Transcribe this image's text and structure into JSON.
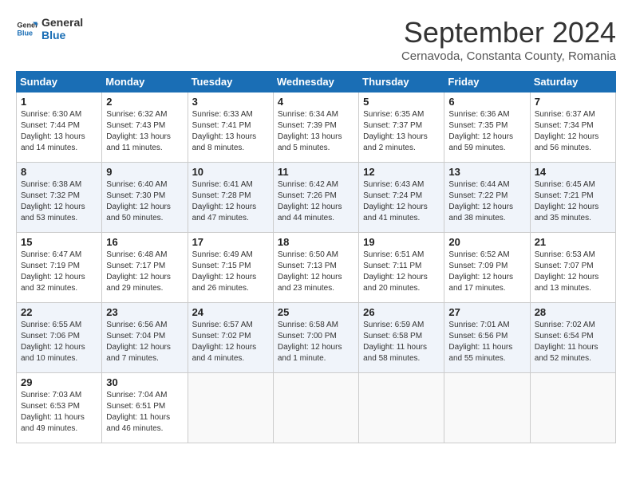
{
  "logo": {
    "line1": "General",
    "line2": "Blue"
  },
  "title": "September 2024",
  "subtitle": "Cernavoda, Constanta County, Romania",
  "days_of_week": [
    "Sunday",
    "Monday",
    "Tuesday",
    "Wednesday",
    "Thursday",
    "Friday",
    "Saturday"
  ],
  "weeks": [
    [
      {
        "day": "1",
        "info": "Sunrise: 6:30 AM\nSunset: 7:44 PM\nDaylight: 13 hours\nand 14 minutes."
      },
      {
        "day": "2",
        "info": "Sunrise: 6:32 AM\nSunset: 7:43 PM\nDaylight: 13 hours\nand 11 minutes."
      },
      {
        "day": "3",
        "info": "Sunrise: 6:33 AM\nSunset: 7:41 PM\nDaylight: 13 hours\nand 8 minutes."
      },
      {
        "day": "4",
        "info": "Sunrise: 6:34 AM\nSunset: 7:39 PM\nDaylight: 13 hours\nand 5 minutes."
      },
      {
        "day": "5",
        "info": "Sunrise: 6:35 AM\nSunset: 7:37 PM\nDaylight: 13 hours\nand 2 minutes."
      },
      {
        "day": "6",
        "info": "Sunrise: 6:36 AM\nSunset: 7:35 PM\nDaylight: 12 hours\nand 59 minutes."
      },
      {
        "day": "7",
        "info": "Sunrise: 6:37 AM\nSunset: 7:34 PM\nDaylight: 12 hours\nand 56 minutes."
      }
    ],
    [
      {
        "day": "8",
        "info": "Sunrise: 6:38 AM\nSunset: 7:32 PM\nDaylight: 12 hours\nand 53 minutes."
      },
      {
        "day": "9",
        "info": "Sunrise: 6:40 AM\nSunset: 7:30 PM\nDaylight: 12 hours\nand 50 minutes."
      },
      {
        "day": "10",
        "info": "Sunrise: 6:41 AM\nSunset: 7:28 PM\nDaylight: 12 hours\nand 47 minutes."
      },
      {
        "day": "11",
        "info": "Sunrise: 6:42 AM\nSunset: 7:26 PM\nDaylight: 12 hours\nand 44 minutes."
      },
      {
        "day": "12",
        "info": "Sunrise: 6:43 AM\nSunset: 7:24 PM\nDaylight: 12 hours\nand 41 minutes."
      },
      {
        "day": "13",
        "info": "Sunrise: 6:44 AM\nSunset: 7:22 PM\nDaylight: 12 hours\nand 38 minutes."
      },
      {
        "day": "14",
        "info": "Sunrise: 6:45 AM\nSunset: 7:21 PM\nDaylight: 12 hours\nand 35 minutes."
      }
    ],
    [
      {
        "day": "15",
        "info": "Sunrise: 6:47 AM\nSunset: 7:19 PM\nDaylight: 12 hours\nand 32 minutes."
      },
      {
        "day": "16",
        "info": "Sunrise: 6:48 AM\nSunset: 7:17 PM\nDaylight: 12 hours\nand 29 minutes."
      },
      {
        "day": "17",
        "info": "Sunrise: 6:49 AM\nSunset: 7:15 PM\nDaylight: 12 hours\nand 26 minutes."
      },
      {
        "day": "18",
        "info": "Sunrise: 6:50 AM\nSunset: 7:13 PM\nDaylight: 12 hours\nand 23 minutes."
      },
      {
        "day": "19",
        "info": "Sunrise: 6:51 AM\nSunset: 7:11 PM\nDaylight: 12 hours\nand 20 minutes."
      },
      {
        "day": "20",
        "info": "Sunrise: 6:52 AM\nSunset: 7:09 PM\nDaylight: 12 hours\nand 17 minutes."
      },
      {
        "day": "21",
        "info": "Sunrise: 6:53 AM\nSunset: 7:07 PM\nDaylight: 12 hours\nand 13 minutes."
      }
    ],
    [
      {
        "day": "22",
        "info": "Sunrise: 6:55 AM\nSunset: 7:06 PM\nDaylight: 12 hours\nand 10 minutes."
      },
      {
        "day": "23",
        "info": "Sunrise: 6:56 AM\nSunset: 7:04 PM\nDaylight: 12 hours\nand 7 minutes."
      },
      {
        "day": "24",
        "info": "Sunrise: 6:57 AM\nSunset: 7:02 PM\nDaylight: 12 hours\nand 4 minutes."
      },
      {
        "day": "25",
        "info": "Sunrise: 6:58 AM\nSunset: 7:00 PM\nDaylight: 12 hours\nand 1 minute."
      },
      {
        "day": "26",
        "info": "Sunrise: 6:59 AM\nSunset: 6:58 PM\nDaylight: 11 hours\nand 58 minutes."
      },
      {
        "day": "27",
        "info": "Sunrise: 7:01 AM\nSunset: 6:56 PM\nDaylight: 11 hours\nand 55 minutes."
      },
      {
        "day": "28",
        "info": "Sunrise: 7:02 AM\nSunset: 6:54 PM\nDaylight: 11 hours\nand 52 minutes."
      }
    ],
    [
      {
        "day": "29",
        "info": "Sunrise: 7:03 AM\nSunset: 6:53 PM\nDaylight: 11 hours\nand 49 minutes."
      },
      {
        "day": "30",
        "info": "Sunrise: 7:04 AM\nSunset: 6:51 PM\nDaylight: 11 hours\nand 46 minutes."
      },
      {
        "day": "",
        "info": ""
      },
      {
        "day": "",
        "info": ""
      },
      {
        "day": "",
        "info": ""
      },
      {
        "day": "",
        "info": ""
      },
      {
        "day": "",
        "info": ""
      }
    ]
  ]
}
